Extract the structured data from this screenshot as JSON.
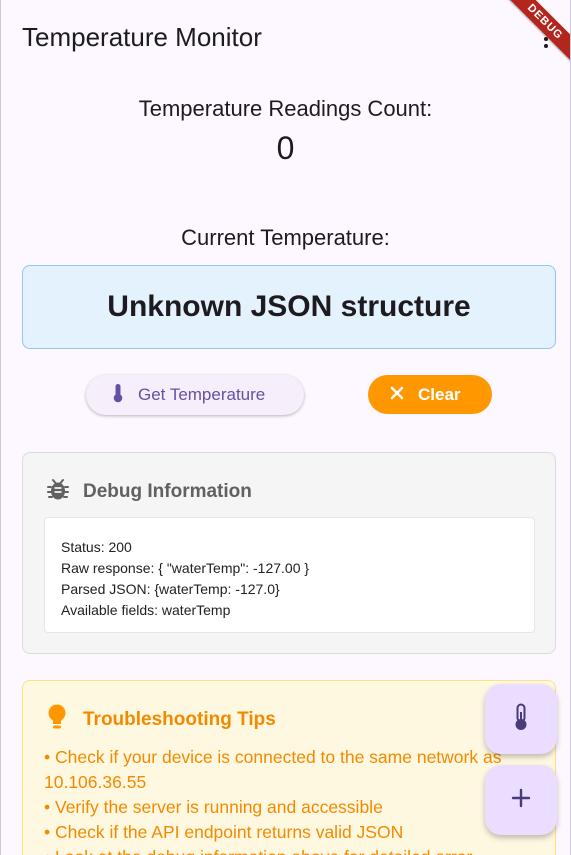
{
  "appbar": {
    "title": "Temperature Monitor",
    "debug_banner": "DEBUG",
    "more_icon": "more-vert-icon"
  },
  "readings": {
    "count_label": "Temperature Readings Count:",
    "count_value": "0"
  },
  "current": {
    "label": "Current Temperature:",
    "value": "Unknown JSON structure"
  },
  "actions": {
    "get_label": "Get Temperature",
    "get_icon": "thermostat-icon",
    "clear_label": "Clear",
    "clear_icon": "close-icon"
  },
  "debug": {
    "title": "Debug Information",
    "icon": "bug-icon",
    "lines": [
      "Status: 200",
      "Raw response: { \"waterTemp\": -127.00 }",
      "Parsed JSON: {waterTemp: -127.0}",
      "Available fields: waterTemp"
    ]
  },
  "tips": {
    "title": "Troubleshooting Tips",
    "icon": "lightbulb-icon",
    "items": [
      "• Check if your device is connected to the same network as 10.106.36.55",
      "• Verify the server is running and accessible",
      "• Check if the API endpoint returns valid JSON",
      "• Look at the debug information above for detailed error"
    ]
  },
  "fabs": {
    "thermo_icon": "thermostat-icon",
    "add_icon": "add-icon"
  },
  "colors": {
    "primary": "#6750a4",
    "accent_orange": "#ff9800",
    "tips_text": "#f28a00",
    "temp_box_bg": "#e3f2fd",
    "fab_bg": "#eaddff"
  }
}
